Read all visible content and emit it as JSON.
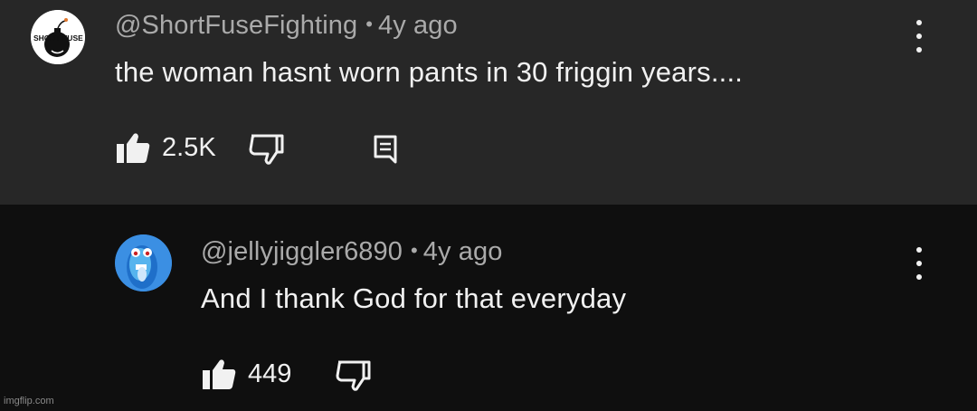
{
  "comments": [
    {
      "username": "@ShortFuseFighting",
      "separator": "•",
      "age": "4y ago",
      "text": "the woman hasnt worn pants in 30 friggin years....",
      "likes": "2.5K",
      "avatar_icon": "bomb-logo-avatar",
      "avatar_text": "SHORT FUSE",
      "has_reply_button": true
    },
    {
      "username": "@jellyjiggler6890",
      "separator": "•",
      "age": "4y ago",
      "text": "And I thank God for that everyday",
      "likes": "449",
      "avatar_icon": "blue-cartoon-face-avatar",
      "has_reply_button": false
    }
  ],
  "icons": {
    "like": "thumbs-up-icon",
    "dislike": "thumbs-down-icon",
    "reply": "reply-comment-icon",
    "menu": "more-vertical-icon"
  },
  "colors": {
    "top_background": "#272727",
    "reply_background": "#0f0f0f",
    "meta_text": "#aaaaaa",
    "body_text": "#f1f1f1"
  },
  "watermark": "imgflip.com"
}
